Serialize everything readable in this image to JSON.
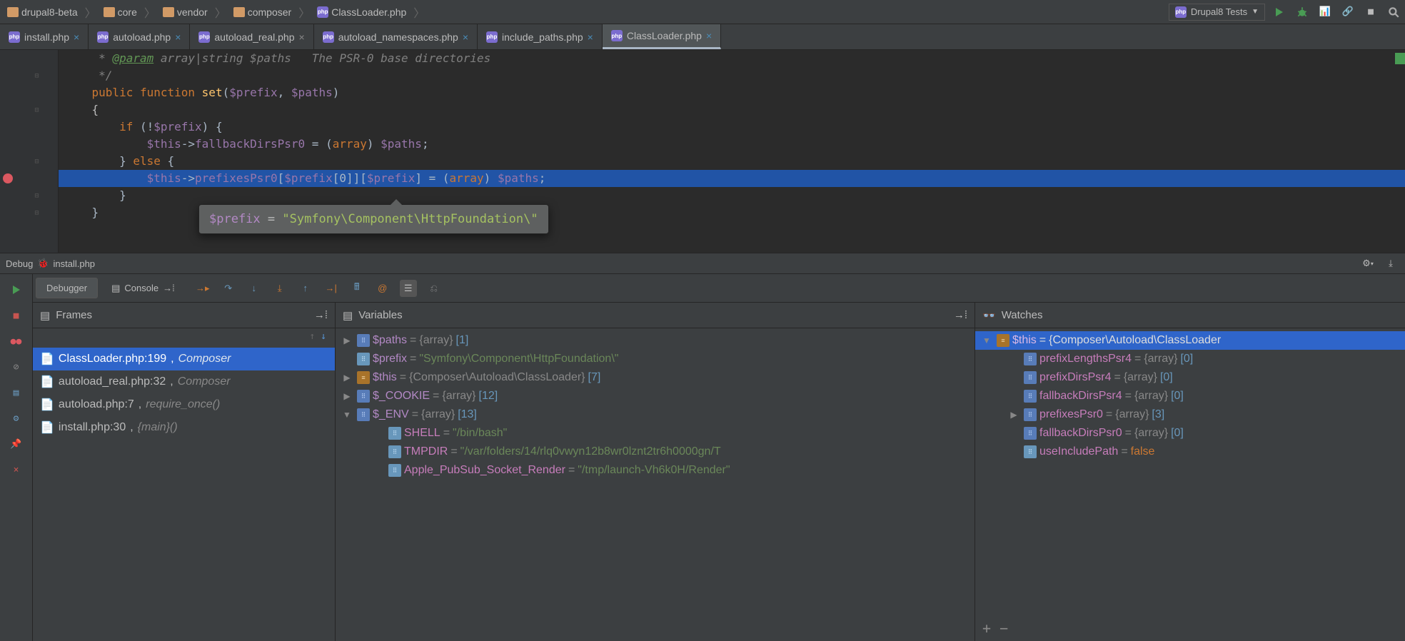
{
  "breadcrumbs": [
    {
      "label": "drupal8-beta",
      "kind": "dir"
    },
    {
      "label": "core",
      "kind": "dir"
    },
    {
      "label": "vendor",
      "kind": "dir"
    },
    {
      "label": "composer",
      "kind": "dir"
    },
    {
      "label": "ClassLoader.php",
      "kind": "php"
    }
  ],
  "run_config": "Drupal8 Tests",
  "tabs": [
    {
      "label": "install.php",
      "modified": true,
      "active": false
    },
    {
      "label": "autoload.php",
      "modified": true,
      "active": false
    },
    {
      "label": "autoload_real.php",
      "modified": false,
      "active": false
    },
    {
      "label": "autoload_namespaces.php",
      "modified": true,
      "active": false
    },
    {
      "label": "include_paths.php",
      "modified": true,
      "active": false
    },
    {
      "label": "ClassLoader.php",
      "modified": true,
      "active": true
    }
  ],
  "code": {
    "comment1": " * @param array|string $paths   The PSR-0 base directories",
    "comment2": " */",
    "fn_kw1": "public",
    "fn_kw2": "function",
    "fn_name": "set",
    "fn_sig_open": "(",
    "fn_p1": "$prefix",
    "fn_comma": ", ",
    "fn_p2": "$paths",
    "fn_sig_close": ")",
    "if_kw": "if",
    "if_cond": " (!$prefix) {",
    "fallback_stmt": "$this->fallbackDirsPsr0 = (array) $paths;",
    "else_line": "} else {",
    "bp_indent": "            ",
    "bp_this": "$this",
    "bp_arrow": "->",
    "bp_prop": "prefixesPsr0",
    "bp_b1": "[",
    "bp_v1": "$prefix",
    "bp_b2": "[",
    "bp_z": "0",
    "bp_b3": "]][",
    "bp_v2": "$prefix",
    "bp_b4": "] = (array) ",
    "bp_v3": "$paths",
    "bp_semi": ";"
  },
  "tooltip": {
    "var": "$prefix",
    "eq": " = ",
    "val": "\"Symfony\\Component\\HttpFoundation\\\""
  },
  "debug_title": "Debug",
  "debug_file": "install.php",
  "debugger_tab": "Debugger",
  "console_tab": "Console",
  "panel_frames": "Frames",
  "panel_vars": "Variables",
  "panel_watches": "Watches",
  "frames": [
    {
      "file": "ClassLoader.php:199",
      "ns": "Composer",
      "active": true
    },
    {
      "file": "autoload_real.php:32",
      "ns": "Composer",
      "active": false
    },
    {
      "file": "autoload.php:7",
      "ns": "require_once()",
      "active": false
    },
    {
      "file": "install.php:30",
      "ns": "{main}()",
      "active": false
    }
  ],
  "vars": [
    {
      "expand": "closed",
      "icon": "arr",
      "name": "$paths",
      "val_type": "{array}",
      "val_after": " [1]"
    },
    {
      "expand": "none",
      "icon": "str",
      "name": "$prefix",
      "val_str": "\"Symfony\\Component\\HttpFoundation\\\""
    },
    {
      "expand": "closed",
      "icon": "obj",
      "name": "$this",
      "val_type": "{Composer\\Autoload\\ClassLoader}",
      "val_after": " [7]"
    },
    {
      "expand": "closed",
      "icon": "arr",
      "name": "$_COOKIE",
      "val_type": "{array}",
      "val_after": " [12]"
    },
    {
      "expand": "open",
      "icon": "arr",
      "name": "$_ENV",
      "val_type": "{array}",
      "val_after": " [13]"
    }
  ],
  "env_children": [
    {
      "name": "SHELL",
      "val": "\"/bin/bash\""
    },
    {
      "name": "TMPDIR",
      "val": "\"/var/folders/14/rlq0vwyn12b8wr0lznt2tr6h0000gn/T"
    },
    {
      "name": "Apple_PubSub_Socket_Render",
      "val": "\"/tmp/launch-Vh6k0H/Render\""
    }
  ],
  "watches": [
    {
      "expand": "open",
      "icon": "obj",
      "name": "$this",
      "val_type": "{Composer\\Autoload\\ClassLoader"
    },
    {
      "indent": 1,
      "icon": "arr",
      "name": "prefixLengthsPsr4",
      "val_type": "{array}",
      "val_after": " [0]"
    },
    {
      "indent": 1,
      "icon": "arr",
      "name": "prefixDirsPsr4",
      "val_type": "{array}",
      "val_after": " [0]"
    },
    {
      "indent": 1,
      "icon": "arr",
      "name": "fallbackDirsPsr4",
      "val_type": "{array}",
      "val_after": " [0]"
    },
    {
      "indent": 1,
      "expand": "closed",
      "icon": "arr",
      "name": "prefixesPsr0",
      "val_type": "{array}",
      "val_after": " [3]"
    },
    {
      "indent": 1,
      "icon": "arr",
      "name": "fallbackDirsPsr0",
      "val_type": "{array}",
      "val_after": " [0]"
    },
    {
      "indent": 1,
      "icon": "str",
      "name": "useIncludePath",
      "val_bool": "false"
    }
  ]
}
